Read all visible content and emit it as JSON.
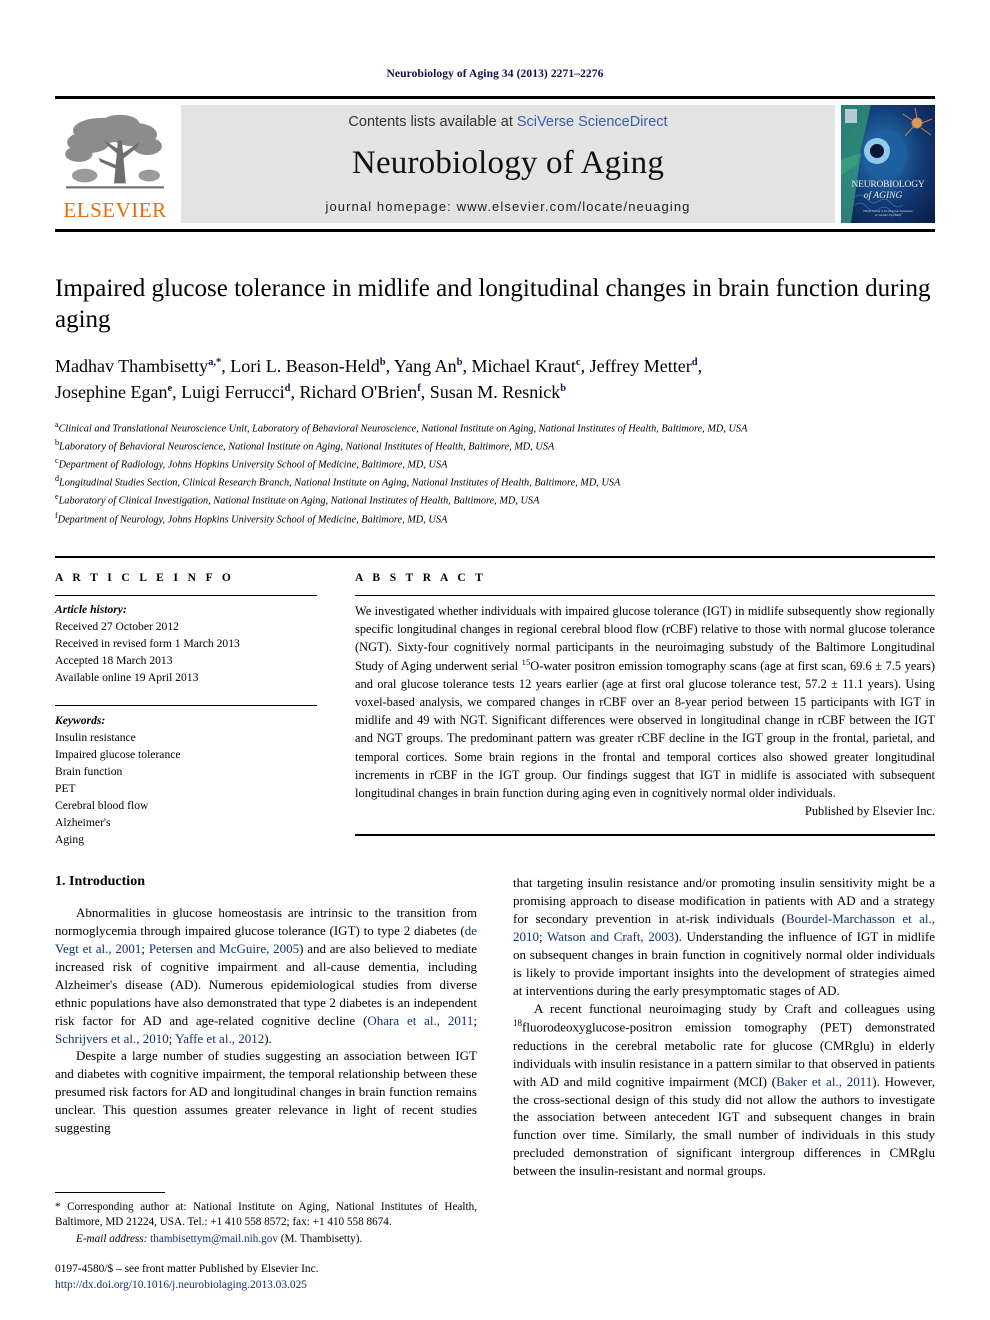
{
  "running_head": "Neurobiology of Aging 34 (2013) 2271–2276",
  "masthead": {
    "publisher_logo_label": "ELSEVIER",
    "contents_prefix": "Contents lists available at ",
    "contents_link": "SciVerse ScienceDirect",
    "journal_title": "Neurobiology of Aging",
    "homepage": "journal homepage: www.elsevier.com/locate/neuaging",
    "cover_title_line1": "NEUROBIOLOGY",
    "cover_title_line2": "of AGING",
    "cover_subtitle": "Official Journal of the American Association for Geriatric Psychiatry"
  },
  "article": {
    "title": "Impaired glucose tolerance in midlife and longitudinal changes in brain function during aging",
    "authors_line1": "Madhav Thambisetty a,*, Lori L. Beason-Held b, Yang An b, Michael Kraut c, Jeffrey Metter d,",
    "authors_line2": "Josephine Egan e, Luigi Ferrucci d, Richard O'Brien f, Susan M. Resnick b",
    "affiliations": [
      {
        "marker": "a",
        "text": "Clinical and Translational Neuroscience Unit, Laboratory of Behavioral Neuroscience, National Institute on Aging, National Institutes of Health, Baltimore, MD, USA"
      },
      {
        "marker": "b",
        "text": "Laboratory of Behavioral Neuroscience, National Institute on Aging, National Institutes of Health, Baltimore, MD, USA"
      },
      {
        "marker": "c",
        "text": "Department of Radiology, Johns Hopkins University School of Medicine, Baltimore, MD, USA"
      },
      {
        "marker": "d",
        "text": "Longitudinal Studies Section, Clinical Research Branch, National Institute on Aging, National Institutes of Health, Baltimore, MD, USA"
      },
      {
        "marker": "e",
        "text": "Laboratory of Clinical Investigation, National Institute on Aging, National Institutes of Health, Baltimore, MD, USA"
      },
      {
        "marker": "f",
        "text": "Department of Neurology, Johns Hopkins University School of Medicine, Baltimore, MD, USA"
      }
    ]
  },
  "article_info": {
    "heading": "A R T I C L E   I N F O",
    "history_label": "Article history:",
    "history": [
      "Received 27 October 2012",
      "Received in revised form 1 March 2013",
      "Accepted 18 March 2013",
      "Available online 19 April 2013"
    ],
    "keywords_label": "Keywords:",
    "keywords": [
      "Insulin resistance",
      "Impaired glucose tolerance",
      "Brain function",
      "PET",
      "Cerebral blood flow",
      "Alzheimer's",
      "Aging"
    ]
  },
  "abstract": {
    "heading": "A B S T R A C T",
    "text_before_sup": "We investigated whether individuals with impaired glucose tolerance (IGT) in midlife subsequently show regionally specific longitudinal changes in regional cerebral blood flow (rCBF) relative to those with normal glucose tolerance (NGT). Sixty-four cognitively normal participants in the neuroimaging substudy of the Baltimore Longitudinal Study of Aging underwent serial ",
    "sup": "15",
    "text_after_sup": "O-water positron emission tomography scans (age at first scan, 69.6 ± 7.5 years) and oral glucose tolerance tests 12 years earlier (age at first oral glucose tolerance test, 57.2 ± 11.1 years). Using voxel-based analysis, we compared changes in rCBF over an 8-year period between 15 participants with IGT in midlife and 49 with NGT. Significant differences were observed in longitudinal change in rCBF between the IGT and NGT groups. The predominant pattern was greater rCBF decline in the IGT group in the frontal, parietal, and temporal cortices. Some brain regions in the frontal and temporal cortices also showed greater longitudinal increments in rCBF in the IGT group. Our findings suggest that IGT in midlife is associated with subsequent longitudinal changes in brain function during aging even in cognitively normal older individuals.",
    "credit": "Published by Elsevier Inc."
  },
  "body": {
    "section_number_title": "1.  Introduction",
    "left_para1_a": "Abnormalities in glucose homeostasis are intrinsic to the transition from normoglycemia through impaired glucose tolerance (IGT) to type 2 diabetes (",
    "left_para1_ref1": "de Vegt et al., 2001",
    "left_para1_b": "; ",
    "left_para1_ref2": "Petersen and McGuire, 2005",
    "left_para1_c": ") and are also believed to mediate increased risk of cognitive impairment and all-cause dementia, including Alzheimer's disease (AD). Numerous epidemiological studies from diverse ethnic populations have also demonstrated that type 2 diabetes is an independent risk factor for AD and age-related cognitive decline (",
    "left_para1_ref3": "Ohara et al., 2011",
    "left_para1_d": "; ",
    "left_para1_ref4": "Schrijvers et al., 2010",
    "left_para1_e": "; ",
    "left_para1_ref5": "Yaffe et al., 2012",
    "left_para1_f": ").",
    "left_para2": "Despite a large number of studies suggesting an association between IGT and diabetes with cognitive impairment, the temporal relationship between these presumed risk factors for AD and longitudinal changes in brain function remains unclear. This question assumes greater relevance in light of recent studies suggesting",
    "right_para1_a": "that targeting insulin resistance and/or promoting insulin sensitivity might be a promising approach to disease modification in patients with AD and a strategy for secondary prevention in at-risk individuals (",
    "right_para1_ref1": "Bourdel-Marchasson et al., 2010",
    "right_para1_b": "; ",
    "right_para1_ref2": "Watson and Craft, 2003",
    "right_para1_c": "). Understanding the influence of IGT in midlife on subsequent changes in brain function in cognitively normal older individuals is likely to provide important insights into the development of strategies aimed at interventions during the early presymptomatic stages of AD.",
    "right_para2_a": "A recent functional neuroimaging study by Craft and colleagues using ",
    "right_para2_sup": "18",
    "right_para2_b": "fluorodeoxyglucose-positron emission tomography (PET) demonstrated reductions in the cerebral metabolic rate for glucose (CMRglu) in elderly individuals with insulin resistance in a pattern similar to that observed in patients with AD and mild cognitive impairment (MCI) (",
    "right_para2_ref1": "Baker et al., 2011",
    "right_para2_c": "). However, the cross-sectional design of this study did not allow the authors to investigate the association between antecedent IGT and subsequent changes in brain function over time. Similarly, the small number of individuals in this study precluded demonstration of significant intergroup differences in CMRglu between the insulin-resistant and normal groups."
  },
  "footnotes": {
    "corresponding": "* Corresponding author at: National Institute on Aging, National Institutes of Health, Baltimore, MD 21224, USA. Tel.: +1 410 558 8572; fax: +1 410 558 8674.",
    "email_label": "E-mail address:",
    "email": "thambisettym@mail.nih.gov",
    "email_suffix": "(M. Thambisetty).",
    "imprint": "0197-4580/$ – see front matter Published by Elsevier Inc.",
    "doi": "http://dx.doi.org/10.1016/j.neurobiolaging.2013.03.025"
  },
  "colors": {
    "elsevier_orange": "#eb6a09",
    "link_blue": "#11306e",
    "band_gray": "#e3e3e3"
  }
}
